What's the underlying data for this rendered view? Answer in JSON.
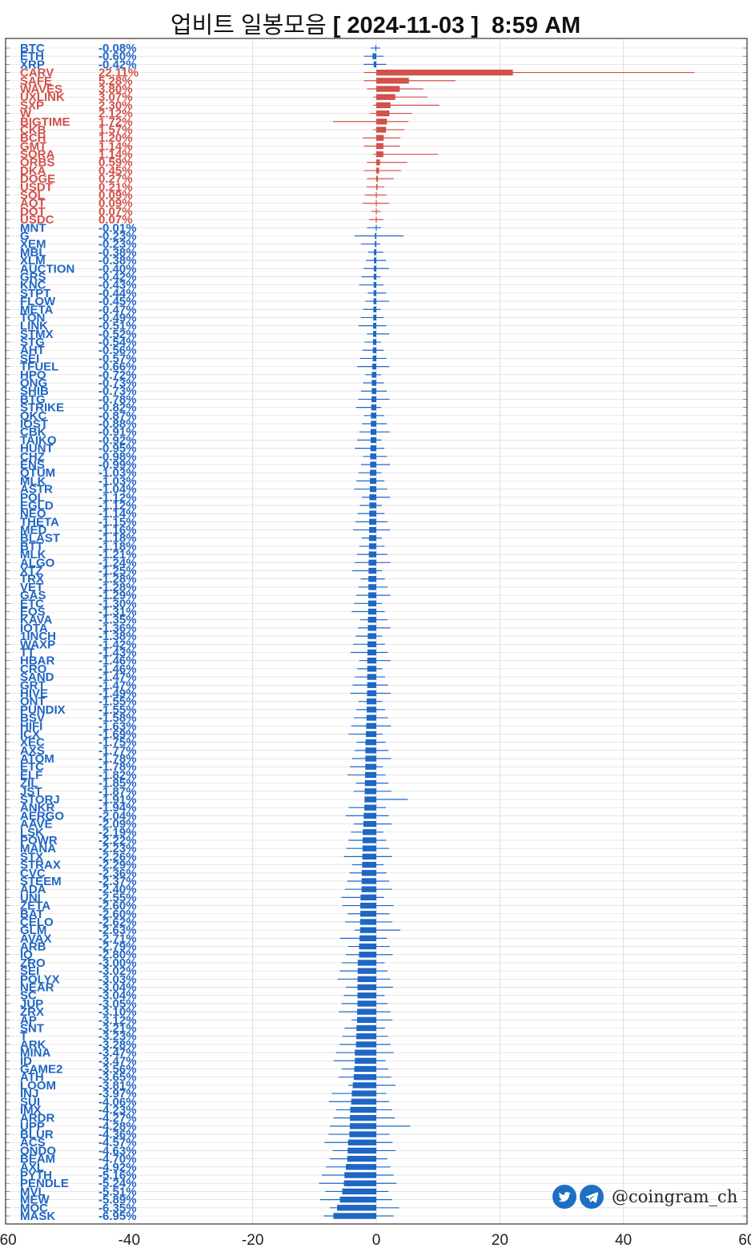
{
  "title": {
    "main": "업비트 일봉모음",
    "date": "[ 2024-11-03 ]  8:59 AM"
  },
  "watermark": {
    "handle": "@coingram_ch",
    "icons": [
      "twitter-icon",
      "telegram-icon"
    ]
  },
  "colors": {
    "up": "#d2514a",
    "down": "#1f66c4",
    "grid": "#d9d9d9",
    "axis": "#333333"
  },
  "chart_data": {
    "type": "bar",
    "orientation": "horizontal",
    "xlim": [
      -60,
      60
    ],
    "xticks": [
      "-60",
      "-40",
      "-20",
      "0",
      "20",
      "40",
      "60"
    ],
    "grid": true,
    "series_note_bar": "body = open-to-close change (%), whisker = high/low range",
    "items": [
      [
        "BTC",
        -0.08,
        "-0.08%"
      ],
      [
        "ETH",
        -0.6,
        "-0.60%"
      ],
      [
        "XRP",
        -0.42,
        "-0.42%"
      ],
      [
        "CARV",
        22.11,
        "22.11%"
      ],
      [
        "SAFE",
        5.28,
        "5.28%"
      ],
      [
        "WAVES",
        3.8,
        "3.80%"
      ],
      [
        "UXLINK",
        3.07,
        "3.07%"
      ],
      [
        "SXP",
        2.3,
        "2.30%"
      ],
      [
        "W",
        2.12,
        "2.12%"
      ],
      [
        "BIGTIME",
        1.72,
        "1.72%"
      ],
      [
        "CKB",
        1.57,
        "1.57%"
      ],
      [
        "BCH",
        1.2,
        "1.20%"
      ],
      [
        "GMT",
        1.14,
        "1.14%"
      ],
      [
        "SORA",
        1.14,
        "1.14%"
      ],
      [
        "ORBS",
        0.59,
        "0.59%"
      ],
      [
        "DKA",
        0.45,
        "0.45%"
      ],
      [
        "DOGE",
        0.27,
        "0.27%"
      ],
      [
        "USDT",
        0.21,
        "0.21%"
      ],
      [
        "SOL",
        0.09,
        "0.09%"
      ],
      [
        "AQT",
        0.09,
        "0.09%"
      ],
      [
        "DOT",
        0.07,
        "0.07%"
      ],
      [
        "USDC",
        0.07,
        "0.07%"
      ],
      [
        "MNT",
        -0.01,
        "-0.01%"
      ],
      [
        "G",
        -0.23,
        "-0.23%"
      ],
      [
        "XEM",
        -0.23,
        "-0.23%"
      ],
      [
        "MBL",
        -0.38,
        "-0.38%"
      ],
      [
        "XLM",
        -0.38,
        "-0.38%"
      ],
      [
        "AUCTION",
        -0.4,
        "-0.40%"
      ],
      [
        "GRS",
        -0.42,
        "-0.42%"
      ],
      [
        "KNC",
        -0.43,
        "-0.43%"
      ],
      [
        "STPT",
        -0.44,
        "-0.44%"
      ],
      [
        "FLOW",
        -0.45,
        "-0.45%"
      ],
      [
        "META",
        -0.47,
        "-0.47%"
      ],
      [
        "TON",
        -0.49,
        "-0.49%"
      ],
      [
        "LINK",
        -0.51,
        "-0.51%"
      ],
      [
        "STMX",
        -0.52,
        "-0.52%"
      ],
      [
        "STG",
        -0.54,
        "-0.54%"
      ],
      [
        "AHT",
        -0.56,
        "-0.56%"
      ],
      [
        "SEI",
        -0.57,
        "-0.57%"
      ],
      [
        "TFUEL",
        -0.66,
        "-0.66%"
      ],
      [
        "HPO",
        -0.72,
        "-0.72%"
      ],
      [
        "ONG",
        -0.73,
        "-0.73%"
      ],
      [
        "SHIB",
        -0.73,
        "-0.73%"
      ],
      [
        "BTG",
        -0.78,
        "-0.78%"
      ],
      [
        "STRIKE",
        -0.82,
        "-0.82%"
      ],
      [
        "QKC",
        -0.87,
        "-0.87%"
      ],
      [
        "IOST",
        -0.88,
        "-0.88%"
      ],
      [
        "CBK",
        -0.91,
        "-0.91%"
      ],
      [
        "TAIKO",
        -0.92,
        "-0.92%"
      ],
      [
        "HUNT",
        -0.95,
        "-0.95%"
      ],
      [
        "CHZ",
        -0.98,
        "-0.98%"
      ],
      [
        "ENS",
        -0.99,
        "-0.99%"
      ],
      [
        "QTUM",
        -1.03,
        "-1.03%"
      ],
      [
        "MLK",
        -1.03,
        "-1.03%"
      ],
      [
        "ASTR",
        -1.04,
        "-1.04%"
      ],
      [
        "POL",
        -1.12,
        "-1.12%"
      ],
      [
        "EGLD",
        -1.12,
        "-1.12%"
      ],
      [
        "NEO",
        -1.14,
        "-1.14%"
      ],
      [
        "THETA",
        -1.15,
        "-1.15%"
      ],
      [
        "MED",
        -1.16,
        "-1.16%"
      ],
      [
        "BLAST",
        -1.18,
        "-1.18%"
      ],
      [
        "BTT",
        -1.18,
        "-1.18%"
      ],
      [
        "MLK",
        -1.21,
        "-1.21%"
      ],
      [
        "ALGO",
        -1.24,
        "-1.24%"
      ],
      [
        "XTZ",
        -1.25,
        "-1.25%"
      ],
      [
        "TRX",
        -1.28,
        "-1.28%"
      ],
      [
        "VET",
        -1.28,
        "-1.28%"
      ],
      [
        "GAS",
        -1.29,
        "-1.29%"
      ],
      [
        "ETC",
        -1.3,
        "-1.30%"
      ],
      [
        "EOS",
        -1.31,
        "-1.31%"
      ],
      [
        "KAVA",
        -1.35,
        "-1.35%"
      ],
      [
        "IOTA",
        -1.36,
        "-1.36%"
      ],
      [
        "1INCH",
        -1.38,
        "-1.38%"
      ],
      [
        "WAXP",
        -1.42,
        "-1.42%"
      ],
      [
        "TT",
        -1.43,
        "-1.43%"
      ],
      [
        "HBAR",
        -1.46,
        "-1.46%"
      ],
      [
        "CRO",
        -1.46,
        "-1.46%"
      ],
      [
        "SAND",
        -1.47,
        "-1.47%"
      ],
      [
        "GRT",
        -1.47,
        "-1.47%"
      ],
      [
        "HIVE",
        -1.49,
        "-1.49%"
      ],
      [
        "ONT",
        -1.55,
        "-1.55%"
      ],
      [
        "PUNDIX",
        -1.55,
        "-1.55%"
      ],
      [
        "BSV",
        -1.58,
        "-1.58%"
      ],
      [
        "HIFI",
        -1.63,
        "-1.63%"
      ],
      [
        "ICX",
        -1.69,
        "-1.69%"
      ],
      [
        "XEC",
        -1.75,
        "-1.75%"
      ],
      [
        "AXS",
        -1.77,
        "-1.77%"
      ],
      [
        "ATOM",
        -1.78,
        "-1.78%"
      ],
      [
        "ETC",
        -1.78,
        "-1.78%"
      ],
      [
        "ELF",
        -1.82,
        "-1.82%"
      ],
      [
        "ZIL",
        -1.85,
        "-1.85%"
      ],
      [
        "JST",
        -1.87,
        "-1.87%"
      ],
      [
        "STORJ",
        -1.91,
        "-1.91%"
      ],
      [
        "ANKR",
        -1.94,
        "-1.94%"
      ],
      [
        "AERGO",
        -2.04,
        "-2.04%"
      ],
      [
        "AAVE",
        -2.09,
        "-2.09%"
      ],
      [
        "LSK",
        -2.19,
        "-2.19%"
      ],
      [
        "POWR",
        -2.22,
        "-2.22%"
      ],
      [
        "MANA",
        -2.23,
        "-2.23%"
      ],
      [
        "STX",
        -2.26,
        "-2.26%"
      ],
      [
        "STRAX",
        -2.29,
        "-2.29%"
      ],
      [
        "CVC",
        -2.36,
        "-2.36%"
      ],
      [
        "STEEM",
        -2.37,
        "-2.37%"
      ],
      [
        "ADA",
        -2.4,
        "-2.40%"
      ],
      [
        "UNI",
        -2.55,
        "-2.55%"
      ],
      [
        "ZETA",
        -2.6,
        "-2.60%"
      ],
      [
        "BAT",
        -2.6,
        "-2.60%"
      ],
      [
        "CELO",
        -2.62,
        "-2.62%"
      ],
      [
        "GLM",
        -2.63,
        "-2.63%"
      ],
      [
        "AVAX",
        -2.71,
        "-2.71%"
      ],
      [
        "ARB",
        -2.79,
        "-2.79%"
      ],
      [
        "IQ",
        -2.8,
        "-2.80%"
      ],
      [
        "ZRO",
        -3.0,
        "-3.00%"
      ],
      [
        "SEI",
        -3.02,
        "-3.02%"
      ],
      [
        "POLYX",
        -3.03,
        "-3.03%"
      ],
      [
        "NEAR",
        -3.04,
        "-3.04%"
      ],
      [
        "SC",
        -3.04,
        "-3.04%"
      ],
      [
        "JUP",
        -3.05,
        "-3.05%"
      ],
      [
        "ZRX",
        -3.1,
        "-3.10%"
      ],
      [
        "AP",
        -3.12,
        "-3.12%"
      ],
      [
        "SNT",
        -3.21,
        "-3.21%"
      ],
      [
        "T",
        -3.23,
        "-3.23%"
      ],
      [
        "ARK",
        -3.28,
        "-3.28%"
      ],
      [
        "MINA",
        -3.47,
        "-3.47%"
      ],
      [
        "ID",
        -3.47,
        "-3.47%"
      ],
      [
        "GAME2",
        -3.56,
        "-3.56%"
      ],
      [
        "ATH",
        -3.65,
        "-3.65%"
      ],
      [
        "LOOM",
        -3.81,
        "-3.81%"
      ],
      [
        "INJ",
        -3.97,
        "-3.97%"
      ],
      [
        "SUI",
        -4.06,
        "-4.06%"
      ],
      [
        "IMX",
        -4.23,
        "-4.23%"
      ],
      [
        "ARDR",
        -4.27,
        "-4.27%"
      ],
      [
        "UPP",
        -4.28,
        "-4.28%"
      ],
      [
        "BLUR",
        -4.36,
        "-4.36%"
      ],
      [
        "ACS",
        -4.57,
        "-4.57%"
      ],
      [
        "ONDO",
        -4.63,
        "-4.63%"
      ],
      [
        "BEAM",
        -4.7,
        "-4.70%"
      ],
      [
        "AXL",
        -4.92,
        "-4.92%"
      ],
      [
        "PYTH",
        -5.16,
        "-5.16%"
      ],
      [
        "PENDLE",
        -5.24,
        "-5.24%"
      ],
      [
        "MVL",
        -5.51,
        "-5.51%"
      ],
      [
        "MEW",
        -5.89,
        "-5.89%"
      ],
      [
        "MOC",
        -6.35,
        "-6.35%"
      ],
      [
        "MASK",
        -6.95,
        "-6.95%"
      ]
    ],
    "ranges": {
      "CARV": [
        -2,
        51.5
      ],
      "SAFE": [
        -2,
        12.8
      ],
      "WAVES": [
        -1.5,
        7.6
      ],
      "UXLINK": [
        -0.5,
        8.3
      ],
      "SXP": [
        -0.5,
        10.2
      ],
      "W": [
        -1,
        5.8
      ],
      "BIGTIME": [
        -7,
        5.2
      ],
      "CKB": [
        -0.5,
        4.6
      ],
      "BCH": [
        -2.2,
        3.9
      ],
      "GMT": [
        -2,
        3.8
      ],
      "SORA": [
        -0.5,
        10
      ],
      "ORBS": [
        -1.5,
        5
      ],
      "DKA": [
        -2,
        4
      ],
      "DOGE": [
        -1.5,
        2.8
      ],
      "MNT": [
        -1.5,
        0.8
      ],
      "G": [
        -3.5,
        4.4
      ],
      "STORJ": [
        -1.5,
        5.1
      ],
      "ZETA": [
        -5.5,
        2.8
      ],
      "GLM": [
        -3.5,
        3.9
      ],
      "UPP": [
        -7.5,
        5.5
      ],
      "MOC": [
        -7.5,
        3.7
      ],
      "MASK": [
        -8.5,
        2.8
      ],
      "AP": [
        -4,
        2.6
      ],
      "LOOM": [
        -4.5,
        3.1
      ]
    }
  }
}
